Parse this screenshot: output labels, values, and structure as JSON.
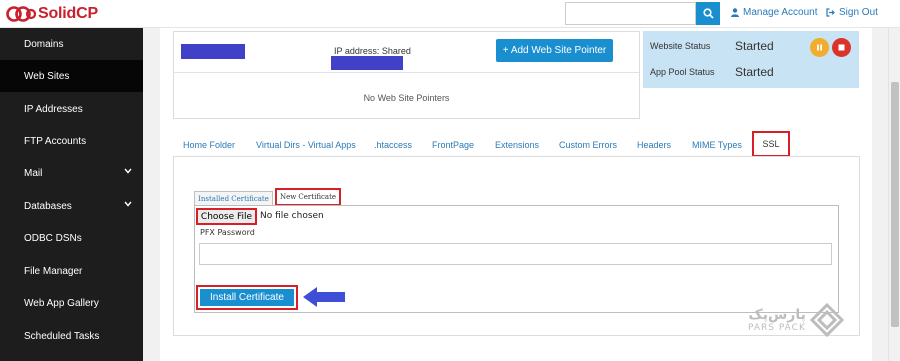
{
  "app": {
    "logo_text": "SolidCP"
  },
  "header": {
    "search": {
      "value": "",
      "placeholder": ""
    },
    "manage_account": "Manage Account",
    "sign_out": "Sign Out"
  },
  "sidebar": {
    "items": [
      {
        "label": "Domains",
        "active": false,
        "has_submenu": false
      },
      {
        "label": "Web Sites",
        "active": true,
        "has_submenu": false
      },
      {
        "label": "IP Addresses",
        "active": false,
        "has_submenu": false
      },
      {
        "label": "FTP Accounts",
        "active": false,
        "has_submenu": false
      },
      {
        "label": "Mail",
        "active": false,
        "has_submenu": true
      },
      {
        "label": "Databases",
        "active": false,
        "has_submenu": true
      },
      {
        "label": "ODBC DSNs",
        "active": false,
        "has_submenu": false
      },
      {
        "label": "File Manager",
        "active": false,
        "has_submenu": false
      },
      {
        "label": "Web App Gallery",
        "active": false,
        "has_submenu": false
      },
      {
        "label": "Scheduled Tasks",
        "active": false,
        "has_submenu": false
      }
    ]
  },
  "site_header": {
    "ip_address": "IP address: Shared",
    "add_pointer_button": "+ Add Web Site Pointer",
    "no_pointers": "No Web Site Pointers"
  },
  "status": {
    "website_label": "Website Status",
    "website_value": "Started",
    "pool_label": "App Pool Status",
    "pool_value": "Started"
  },
  "tabs": [
    "Home Folder",
    "Virtual Dirs - Virtual Apps",
    ".htaccess",
    "FrontPage",
    "Extensions",
    "Custom Errors",
    "Headers",
    "MIME Types",
    "SSL"
  ],
  "active_tab": "SSL",
  "ssl": {
    "subtabs": [
      "Installed Certificate",
      "New Certificate"
    ],
    "active_subtab": "New Certificate",
    "choose_file": "Choose File",
    "file_status": "No file chosen",
    "pfx_label": "PFX Password",
    "pfx_value": "",
    "install_button": "Install Certificate"
  },
  "watermark": {
    "line1": "پارس‌پک",
    "line2": "PARS PACK"
  },
  "colors": {
    "accent": "#1a8fd0",
    "highlight": "#d61f26",
    "sidebar_bg": "#1d1d1d",
    "status_bg": "#c8e3f3",
    "arrow": "#3f4ed6",
    "pause": "#f0ad2e",
    "stop": "#d9342b"
  },
  "icons": [
    "logo-icon",
    "search-icon",
    "user-icon",
    "sign-out-icon",
    "chevron-down-icon",
    "pause-icon",
    "stop-icon",
    "arrow-left-icon",
    "parspack-logo-icon"
  ]
}
